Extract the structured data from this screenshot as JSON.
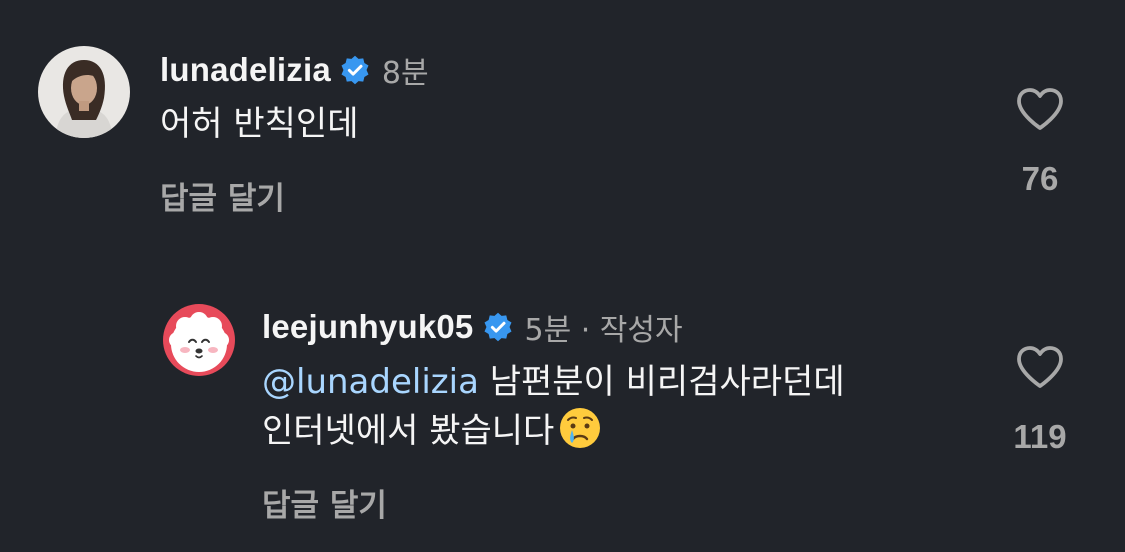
{
  "comments": [
    {
      "username": "lunadelizia",
      "time": "8분",
      "text": "어허 반칙인데",
      "reply_label": "답글 달기",
      "like_count": "76"
    },
    {
      "username": "leejunhyuk05",
      "time": "5분 · 작성자",
      "mention": "@lunadelizia",
      "text_line1": "남편분이 비리검사라던데",
      "text_line2": "인터넷에서 봤습니다",
      "reply_label": "답글 달기",
      "like_count": "119"
    }
  ],
  "colors": {
    "background": "#21242a",
    "text": "#f5f5f5",
    "muted": "#a8a8a8",
    "mention": "#a9d6ff",
    "verified": "#3897f0"
  },
  "icons": {
    "verified": "verified-badge-icon",
    "like": "heart-outline-icon",
    "emoji": "crying-face-emoji"
  }
}
